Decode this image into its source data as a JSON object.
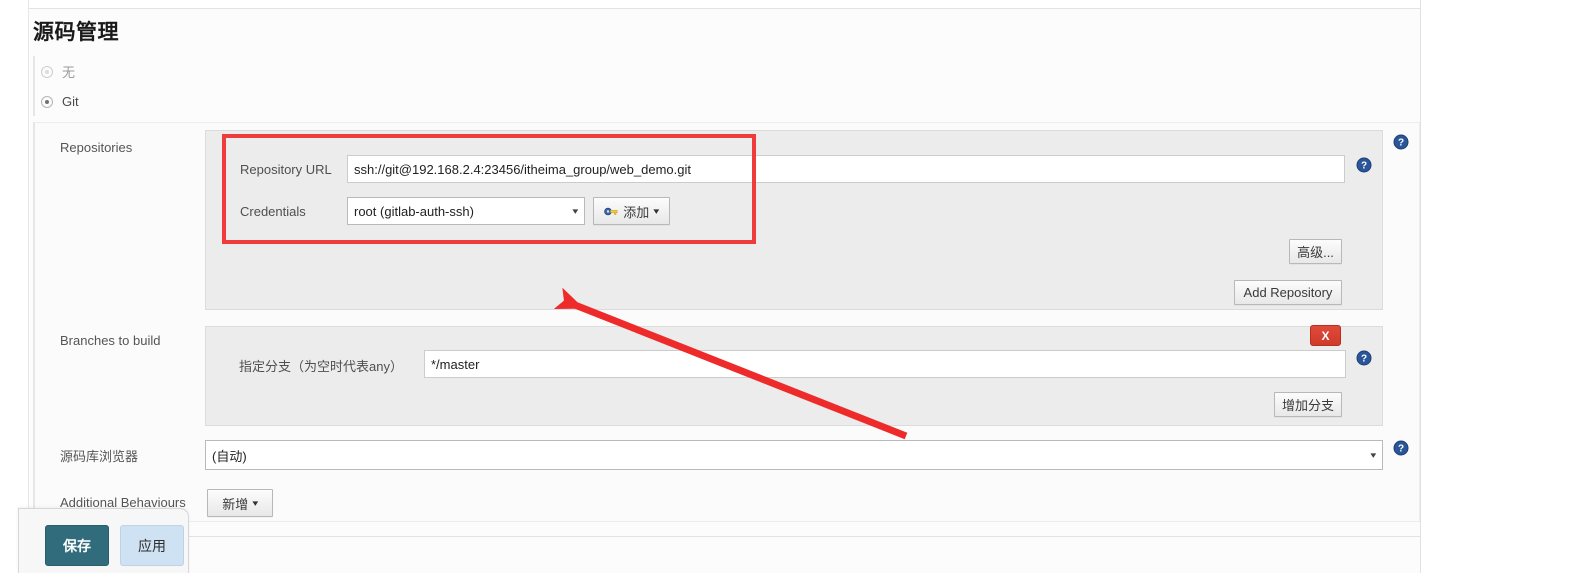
{
  "page": {
    "title": "源码管理"
  },
  "scm_options": [
    {
      "label": "无",
      "selected": false
    },
    {
      "label": "Git",
      "selected": true
    }
  ],
  "fields": {
    "repositories_label": "Repositories",
    "branches_label": "Branches to build",
    "browser_label": "源码库浏览器",
    "additional_behaviours_label": "Additional Behaviours"
  },
  "repository": {
    "url_label": "Repository URL",
    "url_value": "ssh://git@192.168.2.4:23456/itheima_group/web_demo.git",
    "credentials_label": "Credentials",
    "credentials_value": "root (gitlab-auth-ssh)",
    "add_credentials_button": "添加",
    "advanced_button": "高级...",
    "add_repository_button": "Add Repository",
    "delete_button": "X"
  },
  "branches": {
    "specifier_label": "指定分支（为空时代表any）",
    "specifier_value": "*/master",
    "add_branch_button": "增加分支"
  },
  "browser": {
    "value": "(自动)"
  },
  "additional_behaviours": {
    "add_button": "新增"
  },
  "footer": {
    "save_button": "保存",
    "apply_button": "应用"
  },
  "icons": {
    "help": "help-question-icon",
    "key": "key-icon",
    "caret_down": "▾",
    "select_caret": "▾"
  },
  "colors": {
    "annotation_red": "#ee3b3b",
    "save_teal": "#316c7d",
    "apply_blue": "#cfe2f3",
    "delete_red": "#d33b2a",
    "help_blue": "#2a5699"
  }
}
